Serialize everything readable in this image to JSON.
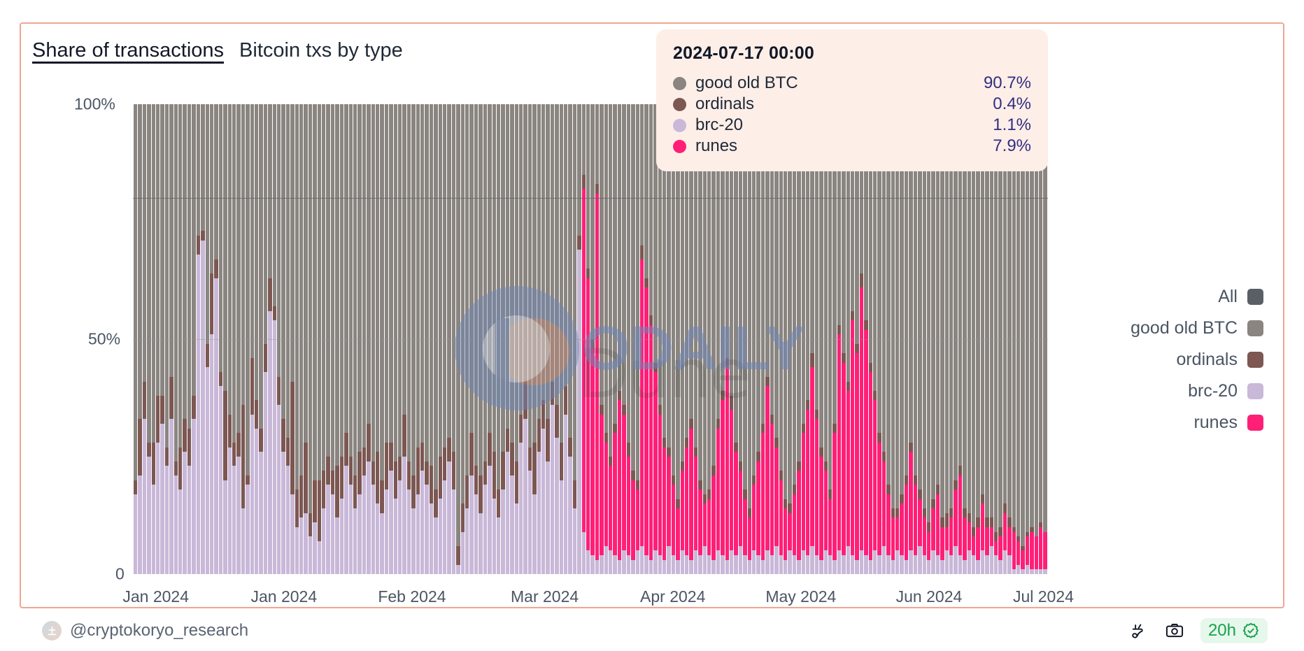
{
  "header": {
    "title_main": "Share of transactions",
    "title_sub": "Bitcoin txs by type"
  },
  "tooltip": {
    "date": "2024-07-17 00:00",
    "rows": [
      {
        "label": "good old BTC",
        "value": "90.7%",
        "color": "#8a8580"
      },
      {
        "label": "ordinals",
        "value": "0.4%",
        "color": "#7d5752"
      },
      {
        "label": "brc-20",
        "value": "1.1%",
        "color": "#c9b8d8"
      },
      {
        "label": "runes",
        "value": "7.9%",
        "color": "#ff1f77"
      }
    ]
  },
  "legend": {
    "items": [
      {
        "label": "All",
        "color": "#5a5f66"
      },
      {
        "label": "good old BTC",
        "color": "#8a8580"
      },
      {
        "label": "ordinals",
        "color": "#7d5752"
      },
      {
        "label": "brc-20",
        "color": "#c9b8d8"
      },
      {
        "label": "runes",
        "color": "#ff1f77"
      }
    ]
  },
  "footer": {
    "handle": "@cryptokoryo_research",
    "freshness": "20h",
    "plug_icon": "plug-icon",
    "camera_icon": "camera-icon",
    "verified_icon": "verified-badge-icon"
  },
  "watermark": {
    "brand": "ODAILY",
    "source": "Dune"
  },
  "chart_data": {
    "type": "bar",
    "stacked": true,
    "normalized": true,
    "title": "Share of transactions",
    "subtitle": "Bitcoin txs by type",
    "xlabel": "",
    "ylabel": "",
    "ylim": [
      0,
      100
    ],
    "yticks": [
      0,
      50,
      100
    ],
    "ytick_labels": [
      "0",
      "50%",
      "100%"
    ],
    "gridlines": [
      80,
      50
    ],
    "legend_position": "right",
    "xtick_labels": [
      "Jan 2024",
      "Jan 2024",
      "Feb 2024",
      "Mar 2024",
      "Apr 2024",
      "May 2024",
      "Jun 2024",
      "Jul 2024"
    ],
    "xtick_positions_pct": [
      2.5,
      16.5,
      30.5,
      45.0,
      59.0,
      73.0,
      87.0,
      99.5
    ],
    "series": [
      {
        "name": "brc-20",
        "color": "#c9b8d8"
      },
      {
        "name": "ordinals",
        "color": "#7d5752"
      },
      {
        "name": "runes",
        "color": "#ff1f77"
      },
      {
        "name": "good old BTC",
        "color": "#8a8580"
      }
    ],
    "bars": [
      {
        "brc": 17,
        "ord": 3,
        "run": 0
      },
      {
        "brc": 21,
        "ord": 12,
        "run": 0
      },
      {
        "brc": 33,
        "ord": 8,
        "run": 0
      },
      {
        "brc": 25,
        "ord": 3,
        "run": 0
      },
      {
        "brc": 19,
        "ord": 9,
        "run": 0
      },
      {
        "brc": 28,
        "ord": 10,
        "run": 0
      },
      {
        "brc": 32,
        "ord": 6,
        "run": 0
      },
      {
        "brc": 23,
        "ord": 4,
        "run": 0
      },
      {
        "brc": 33,
        "ord": 9,
        "run": 0
      },
      {
        "brc": 21,
        "ord": 3,
        "run": 0
      },
      {
        "brc": 18,
        "ord": 9,
        "run": 0
      },
      {
        "brc": 26,
        "ord": 7,
        "run": 0
      },
      {
        "brc": 23,
        "ord": 8,
        "run": 0
      },
      {
        "brc": 33,
        "ord": 5,
        "run": 0
      },
      {
        "brc": 68,
        "ord": 4,
        "run": 0
      },
      {
        "brc": 71,
        "ord": 2,
        "run": 0
      },
      {
        "brc": 44,
        "ord": 5,
        "run": 0
      },
      {
        "brc": 51,
        "ord": 13,
        "run": 0
      },
      {
        "brc": 63,
        "ord": 4,
        "run": 0
      },
      {
        "brc": 40,
        "ord": 3,
        "run": 0
      },
      {
        "brc": 20,
        "ord": 19,
        "run": 0
      },
      {
        "brc": 27,
        "ord": 7,
        "run": 0
      },
      {
        "brc": 23,
        "ord": 5,
        "run": 0
      },
      {
        "brc": 25,
        "ord": 5,
        "run": 0
      },
      {
        "brc": 14,
        "ord": 22,
        "run": 0
      },
      {
        "brc": 19,
        "ord": 2,
        "run": 0
      },
      {
        "brc": 34,
        "ord": 12,
        "run": 0
      },
      {
        "brc": 31,
        "ord": 6,
        "run": 0
      },
      {
        "brc": 26,
        "ord": 5,
        "run": 0
      },
      {
        "brc": 43,
        "ord": 6,
        "run": 0
      },
      {
        "brc": 56,
        "ord": 7,
        "run": 0
      },
      {
        "brc": 54,
        "ord": 3,
        "run": 0
      },
      {
        "brc": 36,
        "ord": 6,
        "run": 0
      },
      {
        "brc": 26,
        "ord": 7,
        "run": 0
      },
      {
        "brc": 23,
        "ord": 6,
        "run": 0
      },
      {
        "brc": 17,
        "ord": 24,
        "run": 0
      },
      {
        "brc": 10,
        "ord": 8,
        "run": 0
      },
      {
        "brc": 12,
        "ord": 9,
        "run": 0
      },
      {
        "brc": 13,
        "ord": 15,
        "run": 0
      },
      {
        "brc": 8,
        "ord": 5,
        "run": 0
      },
      {
        "brc": 11,
        "ord": 9,
        "run": 0
      },
      {
        "brc": 7,
        "ord": 13,
        "run": 0
      },
      {
        "brc": 14,
        "ord": 8,
        "run": 0
      },
      {
        "brc": 19,
        "ord": 6,
        "run": 0
      },
      {
        "brc": 17,
        "ord": 5,
        "run": 0
      },
      {
        "brc": 12,
        "ord": 11,
        "run": 0
      },
      {
        "brc": 16,
        "ord": 9,
        "run": 0
      },
      {
        "brc": 23,
        "ord": 7,
        "run": 0
      },
      {
        "brc": 19,
        "ord": 6,
        "run": 0
      },
      {
        "brc": 14,
        "ord": 7,
        "run": 0
      },
      {
        "brc": 17,
        "ord": 9,
        "run": 0
      },
      {
        "brc": 21,
        "ord": 6,
        "run": 0
      },
      {
        "brc": 24,
        "ord": 8,
        "run": 0
      },
      {
        "brc": 19,
        "ord": 5,
        "run": 0
      },
      {
        "brc": 15,
        "ord": 11,
        "run": 0
      },
      {
        "brc": 13,
        "ord": 7,
        "run": 0
      },
      {
        "brc": 18,
        "ord": 10,
        "run": 0
      },
      {
        "brc": 22,
        "ord": 6,
        "run": 0
      },
      {
        "brc": 16,
        "ord": 8,
        "run": 0
      },
      {
        "brc": 20,
        "ord": 5,
        "run": 0
      },
      {
        "brc": 25,
        "ord": 9,
        "run": 0
      },
      {
        "brc": 18,
        "ord": 6,
        "run": 0
      },
      {
        "brc": 14,
        "ord": 7,
        "run": 0
      },
      {
        "brc": 17,
        "ord": 10,
        "run": 0
      },
      {
        "brc": 22,
        "ord": 6,
        "run": 0
      },
      {
        "brc": 19,
        "ord": 5,
        "run": 0
      },
      {
        "brc": 15,
        "ord": 8,
        "run": 0
      },
      {
        "brc": 12,
        "ord": 6,
        "run": 0
      },
      {
        "brc": 16,
        "ord": 9,
        "run": 0
      },
      {
        "brc": 20,
        "ord": 7,
        "run": 0
      },
      {
        "brc": 24,
        "ord": 5,
        "run": 0
      },
      {
        "brc": 18,
        "ord": 8,
        "run": 0
      },
      {
        "brc": 2,
        "ord": 4,
        "run": 0
      },
      {
        "brc": 9,
        "ord": 6,
        "run": 0
      },
      {
        "brc": 14,
        "ord": 7,
        "run": 0
      },
      {
        "brc": 21,
        "ord": 9,
        "run": 0
      },
      {
        "brc": 17,
        "ord": 6,
        "run": 0
      },
      {
        "brc": 13,
        "ord": 8,
        "run": 0
      },
      {
        "brc": 19,
        "ord": 5,
        "run": 0
      },
      {
        "brc": 23,
        "ord": 7,
        "run": 0
      },
      {
        "brc": 16,
        "ord": 10,
        "run": 0
      },
      {
        "brc": 12,
        "ord": 6,
        "run": 0
      },
      {
        "brc": 18,
        "ord": 8,
        "run": 0
      },
      {
        "brc": 26,
        "ord": 5,
        "run": 0
      },
      {
        "brc": 21,
        "ord": 7,
        "run": 0
      },
      {
        "brc": 15,
        "ord": 9,
        "run": 0
      },
      {
        "brc": 28,
        "ord": 6,
        "run": 0
      },
      {
        "brc": 33,
        "ord": 8,
        "run": 0
      },
      {
        "brc": 22,
        "ord": 5,
        "run": 0
      },
      {
        "brc": 17,
        "ord": 11,
        "run": 0
      },
      {
        "brc": 26,
        "ord": 7,
        "run": 0
      },
      {
        "brc": 31,
        "ord": 6,
        "run": 0
      },
      {
        "brc": 24,
        "ord": 9,
        "run": 0
      },
      {
        "brc": 36,
        "ord": 5,
        "run": 0
      },
      {
        "brc": 29,
        "ord": 7,
        "run": 0
      },
      {
        "brc": 20,
        "ord": 8,
        "run": 0
      },
      {
        "brc": 34,
        "ord": 6,
        "run": 0
      },
      {
        "brc": 25,
        "ord": 4,
        "run": 0
      },
      {
        "brc": 14,
        "ord": 6,
        "run": 0
      },
      {
        "brc": 69,
        "ord": 3,
        "run": 0
      },
      {
        "brc": 9,
        "ord": 3,
        "run": 73
      },
      {
        "brc": 5,
        "ord": 2,
        "run": 58
      },
      {
        "brc": 4,
        "ord": 2,
        "run": 44
      },
      {
        "brc": 3,
        "ord": 2,
        "run": 78
      },
      {
        "brc": 4,
        "ord": 2,
        "run": 30
      },
      {
        "brc": 6,
        "ord": 2,
        "run": 22
      },
      {
        "brc": 5,
        "ord": 2,
        "run": 18
      },
      {
        "brc": 4,
        "ord": 2,
        "run": 26
      },
      {
        "brc": 3,
        "ord": 2,
        "run": 34
      },
      {
        "brc": 5,
        "ord": 2,
        "run": 29
      },
      {
        "brc": 4,
        "ord": 3,
        "run": 21
      },
      {
        "brc": 3,
        "ord": 2,
        "run": 17
      },
      {
        "brc": 5,
        "ord": 2,
        "run": 13
      },
      {
        "brc": 6,
        "ord": 3,
        "run": 61
      },
      {
        "brc": 4,
        "ord": 2,
        "run": 57
      },
      {
        "brc": 3,
        "ord": 2,
        "run": 50
      },
      {
        "brc": 5,
        "ord": 2,
        "run": 38
      },
      {
        "brc": 4,
        "ord": 2,
        "run": 30
      },
      {
        "brc": 3,
        "ord": 2,
        "run": 24
      },
      {
        "brc": 6,
        "ord": 2,
        "run": 19
      },
      {
        "brc": 4,
        "ord": 2,
        "run": 15
      },
      {
        "brc": 3,
        "ord": 2,
        "run": 11
      },
      {
        "brc": 5,
        "ord": 2,
        "run": 17
      },
      {
        "brc": 4,
        "ord": 2,
        "run": 23
      },
      {
        "brc": 3,
        "ord": 2,
        "run": 28
      },
      {
        "brc": 5,
        "ord": 2,
        "run": 20
      },
      {
        "brc": 4,
        "ord": 2,
        "run": 14
      },
      {
        "brc": 6,
        "ord": 2,
        "run": 9
      },
      {
        "brc": 4,
        "ord": 2,
        "run": 12
      },
      {
        "brc": 3,
        "ord": 2,
        "run": 18
      },
      {
        "brc": 5,
        "ord": 2,
        "run": 26
      },
      {
        "brc": 4,
        "ord": 2,
        "run": 33
      },
      {
        "brc": 3,
        "ord": 2,
        "run": 41
      },
      {
        "brc": 5,
        "ord": 3,
        "run": 30
      },
      {
        "brc": 4,
        "ord": 2,
        "run": 22
      },
      {
        "brc": 6,
        "ord": 2,
        "run": 16
      },
      {
        "brc": 4,
        "ord": 2,
        "run": 12
      },
      {
        "brc": 3,
        "ord": 2,
        "run": 9
      },
      {
        "brc": 5,
        "ord": 2,
        "run": 14
      },
      {
        "brc": 4,
        "ord": 2,
        "run": 20
      },
      {
        "brc": 3,
        "ord": 2,
        "run": 27
      },
      {
        "brc": 5,
        "ord": 2,
        "run": 35
      },
      {
        "brc": 4,
        "ord": 2,
        "run": 28
      },
      {
        "brc": 6,
        "ord": 2,
        "run": 21
      },
      {
        "brc": 4,
        "ord": 2,
        "run": 16
      },
      {
        "brc": 3,
        "ord": 2,
        "run": 11
      },
      {
        "brc": 5,
        "ord": 2,
        "run": 8
      },
      {
        "brc": 4,
        "ord": 2,
        "run": 13
      },
      {
        "brc": 3,
        "ord": 2,
        "run": 19
      },
      {
        "brc": 5,
        "ord": 2,
        "run": 25
      },
      {
        "brc": 4,
        "ord": 2,
        "run": 31
      },
      {
        "brc": 6,
        "ord": 3,
        "run": 38
      },
      {
        "brc": 4,
        "ord": 2,
        "run": 29
      },
      {
        "brc": 3,
        "ord": 2,
        "run": 22
      },
      {
        "brc": 5,
        "ord": 2,
        "run": 17
      },
      {
        "brc": 4,
        "ord": 2,
        "run": 12
      },
      {
        "brc": 3,
        "ord": 2,
        "run": 27
      },
      {
        "brc": 5,
        "ord": 2,
        "run": 46
      },
      {
        "brc": 4,
        "ord": 2,
        "run": 41
      },
      {
        "brc": 6,
        "ord": 2,
        "run": 33
      },
      {
        "brc": 4,
        "ord": 2,
        "run": 50
      },
      {
        "brc": 3,
        "ord": 2,
        "run": 44
      },
      {
        "brc": 5,
        "ord": 3,
        "run": 56
      },
      {
        "brc": 4,
        "ord": 2,
        "run": 48
      },
      {
        "brc": 3,
        "ord": 2,
        "run": 40
      },
      {
        "brc": 5,
        "ord": 2,
        "run": 32
      },
      {
        "brc": 4,
        "ord": 2,
        "run": 24
      },
      {
        "brc": 6,
        "ord": 2,
        "run": 18
      },
      {
        "brc": 4,
        "ord": 2,
        "run": 13
      },
      {
        "brc": 3,
        "ord": 2,
        "run": 9
      },
      {
        "brc": 5,
        "ord": 2,
        "run": 7
      },
      {
        "brc": 4,
        "ord": 2,
        "run": 11
      },
      {
        "brc": 3,
        "ord": 2,
        "run": 16
      },
      {
        "brc": 5,
        "ord": 2,
        "run": 21
      },
      {
        "brc": 4,
        "ord": 2,
        "run": 15
      },
      {
        "brc": 6,
        "ord": 2,
        "run": 10
      },
      {
        "brc": 4,
        "ord": 2,
        "run": 8
      },
      {
        "brc": 3,
        "ord": 2,
        "run": 6
      },
      {
        "brc": 5,
        "ord": 2,
        "run": 9
      },
      {
        "brc": 4,
        "ord": 2,
        "run": 13
      },
      {
        "brc": 3,
        "ord": 2,
        "run": 7
      },
      {
        "brc": 5,
        "ord": 3,
        "run": 5
      },
      {
        "brc": 4,
        "ord": 2,
        "run": 8
      },
      {
        "brc": 6,
        "ord": 2,
        "run": 12
      },
      {
        "brc": 4,
        "ord": 2,
        "run": 17
      },
      {
        "brc": 3,
        "ord": 2,
        "run": 9
      },
      {
        "brc": 5,
        "ord": 2,
        "run": 6
      },
      {
        "brc": 4,
        "ord": 2,
        "run": 4
      },
      {
        "brc": 3,
        "ord": 2,
        "run": 7
      },
      {
        "brc": 5,
        "ord": 2,
        "run": 10
      },
      {
        "brc": 4,
        "ord": 2,
        "run": 6
      },
      {
        "brc": 6,
        "ord": 2,
        "run": 4
      },
      {
        "brc": 4,
        "ord": 2,
        "run": 3
      },
      {
        "brc": 3,
        "ord": 2,
        "run": 5
      },
      {
        "brc": 5,
        "ord": 2,
        "run": 8
      },
      {
        "brc": 4,
        "ord": 2,
        "run": 6
      },
      {
        "brc": 1,
        "ord": 1,
        "run": 8
      },
      {
        "brc": 2,
        "ord": 1,
        "run": 5
      },
      {
        "brc": 1,
        "ord": 1,
        "run": 4
      },
      {
        "brc": 2,
        "ord": 1,
        "run": 6
      },
      {
        "brc": 1,
        "ord": 1,
        "run": 8
      },
      {
        "brc": 1,
        "ord": 0,
        "run": 7
      },
      {
        "brc": 1,
        "ord": 1,
        "run": 9
      },
      {
        "brc": 1,
        "ord": 0,
        "run": 8
      }
    ]
  }
}
